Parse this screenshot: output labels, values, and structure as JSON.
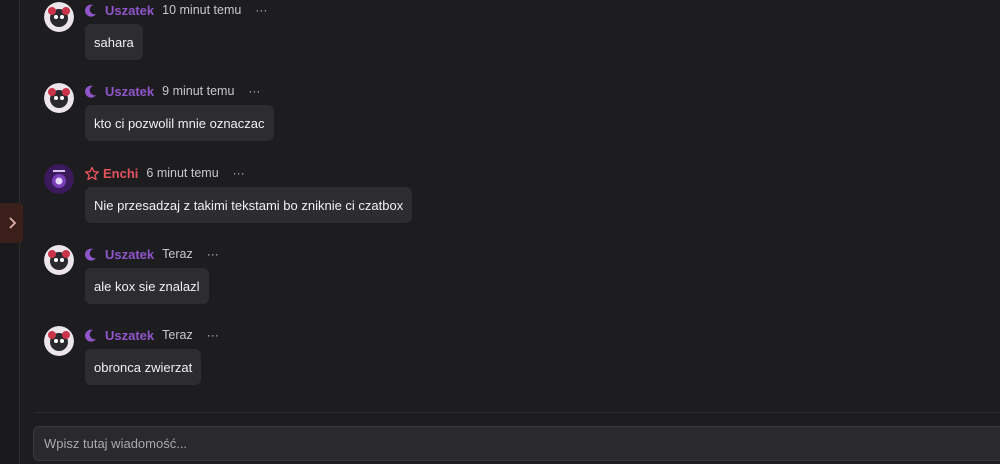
{
  "messages": [
    {
      "author": "Uszatek",
      "author_color": "purple",
      "rank_icon": "moon-icon",
      "time": "10 minut temu",
      "more": "···",
      "text": "sahara"
    },
    {
      "author": "Uszatek",
      "author_color": "purple",
      "rank_icon": "moon-icon",
      "time": "9 minut temu",
      "more": "···",
      "text": "kto ci pozwolil mnie oznaczac"
    },
    {
      "author": "Enchi",
      "author_color": "red",
      "rank_icon": "star-icon",
      "time": "6 minut temu",
      "more": "···",
      "text": "Nie przesadzaj z takimi tekstami bo zniknie ci czatbox"
    },
    {
      "author": "Uszatek",
      "author_color": "purple",
      "rank_icon": "moon-icon",
      "time": "Teraz",
      "more": "···",
      "text": "ale kox sie znalazl"
    },
    {
      "author": "Uszatek",
      "author_color": "purple",
      "rank_icon": "moon-icon",
      "time": "Teraz",
      "more": "···",
      "text": "obronca zwierzat"
    }
  ],
  "composer": {
    "placeholder": "Wpisz tutaj wiadomość..."
  },
  "colors": {
    "purple": "#8f55c9",
    "red": "#e2525b",
    "background": "#1d1d20",
    "bubble": "#2c2c31"
  }
}
